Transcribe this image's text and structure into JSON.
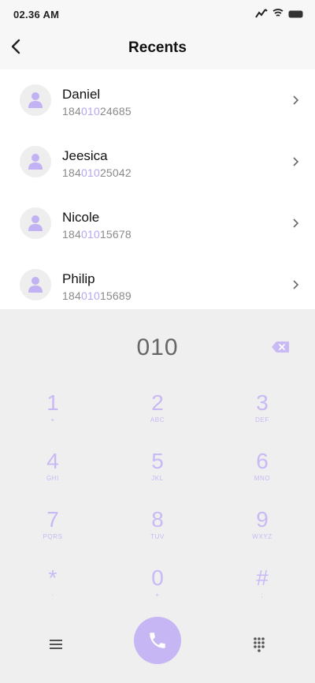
{
  "status_bar": {
    "time": "02.36 AM",
    "icons": [
      "signal-icon",
      "wifi-icon",
      "battery-icon"
    ]
  },
  "header": {
    "title": "Recents",
    "back_icon": "chevron-left-icon"
  },
  "contacts": [
    {
      "name": "Daniel",
      "number_prefix": "184",
      "number_match": "010",
      "number_suffix": "24685"
    },
    {
      "name": "Jeesica",
      "number_prefix": "184",
      "number_match": "010",
      "number_suffix": "25042"
    },
    {
      "name": "Nicole",
      "number_prefix": "184",
      "number_match": "010",
      "number_suffix": "15678"
    },
    {
      "name": "Philip",
      "number_prefix": "184",
      "number_match": "010",
      "number_suffix": "15689"
    }
  ],
  "dialpad": {
    "entry": "010",
    "keys": [
      {
        "digit": "1",
        "letters": "⌖"
      },
      {
        "digit": "2",
        "letters": "ABC"
      },
      {
        "digit": "3",
        "letters": "DEF"
      },
      {
        "digit": "4",
        "letters": "GHI"
      },
      {
        "digit": "5",
        "letters": "JKL"
      },
      {
        "digit": "6",
        "letters": "MNO"
      },
      {
        "digit": "7",
        "letters": "PQRS"
      },
      {
        "digit": "8",
        "letters": "TUV"
      },
      {
        "digit": "9",
        "letters": "WXYZ"
      },
      {
        "digit": "*",
        "letters": "·"
      },
      {
        "digit": "0",
        "letters": "+"
      },
      {
        "digit": "#",
        "letters": ";"
      }
    ]
  },
  "colors": {
    "accent": "#c7b6f4",
    "highlight": "#b7a6f2",
    "dialpad_bg": "#efefef"
  }
}
